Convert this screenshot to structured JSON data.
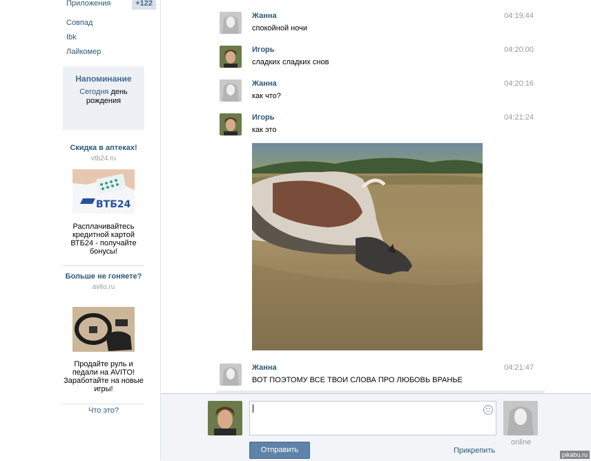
{
  "sidebar": {
    "apps": {
      "label": "Приложения",
      "count": "+122"
    },
    "links": [
      "Совпад",
      "Ibk",
      "Лайкомер"
    ],
    "reminder": {
      "title": "Напоминание",
      "today": "Сегодня",
      "text": "день рождения"
    },
    "ads": [
      {
        "title": "Скидка в аптеках!",
        "domain": "vtb24.ru",
        "brand": "ВТБ24",
        "text": "Расплачивайтесь кредитной картой ВТБ24 - получайте бонусы!"
      },
      {
        "title": "Больше не гоняете?",
        "domain": "avito.ru",
        "text": "Продайте руль и педали на AVITO! Заработайте на новые игры!"
      }
    ],
    "what_is": "Что это?"
  },
  "messages": [
    {
      "author": "Жанна",
      "time": "04:19:44",
      "text": "спокойной ночи"
    },
    {
      "author": "Игорь",
      "time": "04:20:00",
      "text": "сладких сладких снов"
    },
    {
      "author": "Жанна",
      "time": "04:20:16",
      "text": "как что?"
    },
    {
      "author": "Игорь",
      "time": "04:21:24",
      "text": "как это"
    },
    {
      "author": "Жанна",
      "time": "04:21:47",
      "text": "ВОТ ПОЭТОМУ ВСЕ ТВОИ СЛОВА ПРО ЛЮБОВЬ ВРАНЬЕ"
    }
  ],
  "composer": {
    "send_label": "Отправить",
    "attach_label": "Прикрепить",
    "status": "online",
    "input_value": ""
  },
  "watermark": "pikabu.ru",
  "colors": {
    "link": "#2b587a",
    "button": "#5e82a8",
    "muted": "#999999",
    "panel": "#edf1f5"
  }
}
